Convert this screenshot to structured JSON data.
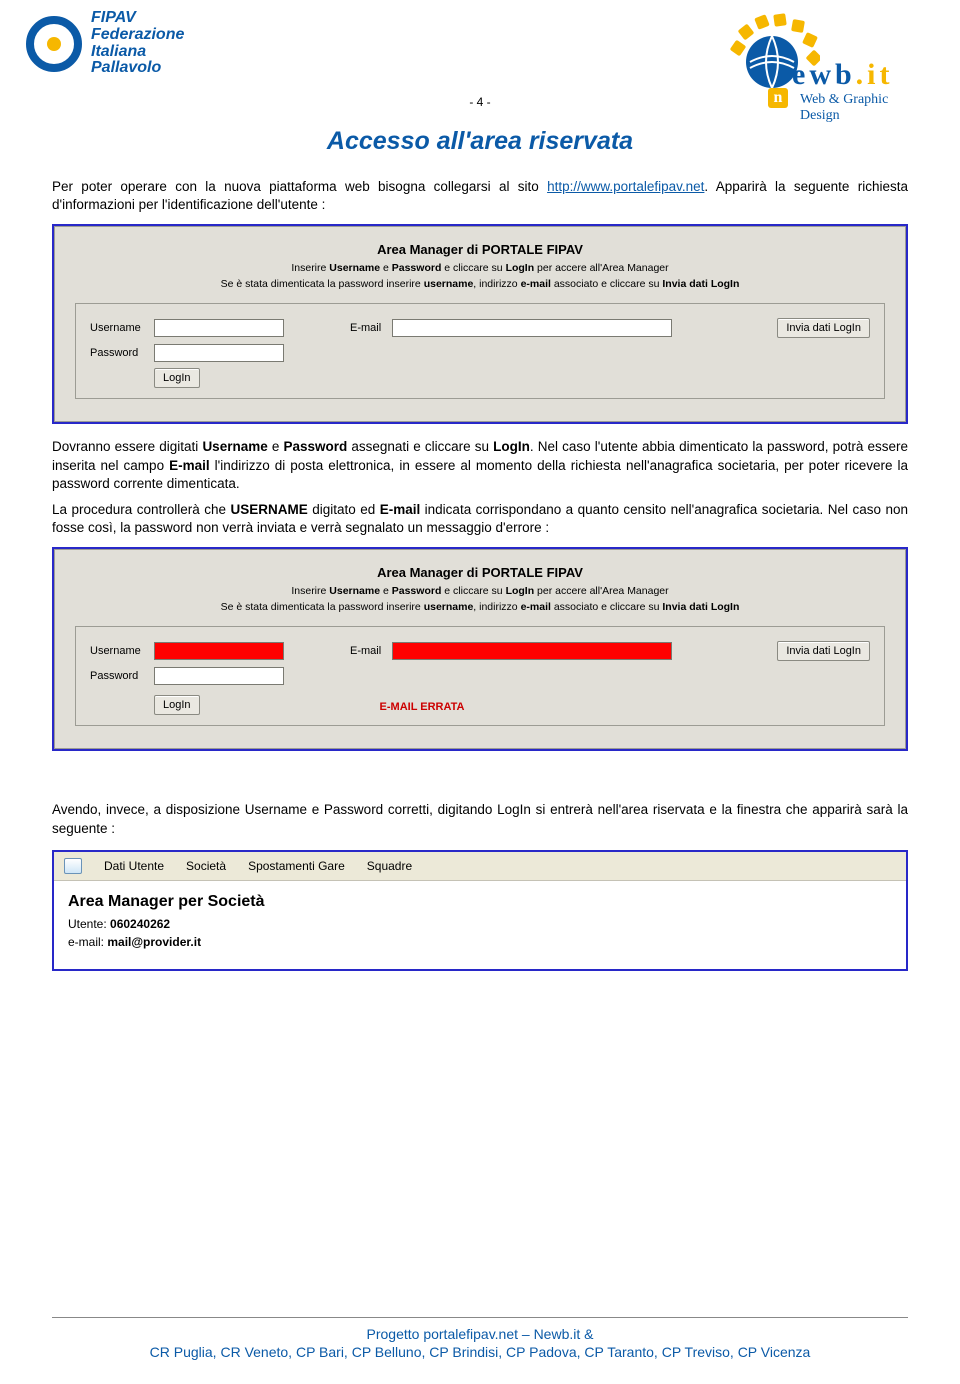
{
  "header": {
    "page_number": "- 4 -",
    "fipav": {
      "line1": "FIPAV",
      "line2": "Federazione",
      "line3": "Italiana",
      "line4": "Pallavolo"
    },
    "newb": {
      "brand_part1": "ewb",
      "brand_part2": ".it",
      "tag": "Web & Graphic Design",
      "n": "n"
    }
  },
  "title": "Accesso all'area riservata",
  "intro_pre": "Per poter operare con la nuova piattaforma web bisogna collegarsi al sito ",
  "intro_link": "http://www.portalefipav.net",
  "intro_post": ". Apparirà la seguente richiesta d'informazioni per l'identificazione dell'utente :",
  "panel1": {
    "title": "Area Manager di PORTALE FIPAV",
    "sub1_a": "Inserire ",
    "sub1_b": "Username",
    "sub1_c": " e ",
    "sub1_d": "Password",
    "sub1_e": " e cliccare su ",
    "sub1_f": "LogIn",
    "sub1_g": " per accere all'Area Manager",
    "sub2_a": "Se è stata dimenticata la password inserire ",
    "sub2_b": "username",
    "sub2_c": ", indirizzo ",
    "sub2_d": "e-mail",
    "sub2_e": " associato e cliccare su ",
    "sub2_f": "Invia dati LogIn",
    "username_label": "Username",
    "password_label": "Password",
    "email_label": "E-mail",
    "invia_btn": "Invia dati LogIn",
    "login_btn": "LogIn"
  },
  "para2_a": "Dovranno essere digitati ",
  "para2_b": "Username",
  "para2_c": " e ",
  "para2_d": "Password",
  "para2_e": " assegnati e cliccare su ",
  "para2_f": "LogIn",
  "para2_g": ". Nel caso l'utente abbia dimenticato la password, potrà essere inserita nel campo ",
  "para2_h": "E-mail",
  "para2_i": " l'indirizzo di posta elettronica, in essere al momento della richiesta nell'anagrafica societaria, per poter ricevere la password corrente dimenticata.",
  "para3_a": "La procedura controllerà che ",
  "para3_b": "USERNAME",
  "para3_c": " digitato ed ",
  "para3_d": "E-mail",
  "para3_e": " indicata corrispondano a quanto censito nell'anagrafica societaria. Nel caso non fosse così, la password non verrà inviata e verrà segnalato un messaggio d'errore :",
  "panel2": {
    "error": "E-MAIL ERRATA"
  },
  "para4": "Avendo, invece, a disposizione Username e Password corretti, digitando LogIn si entrerà nell'area riservata e la finestra che apparirà sarà la seguente :",
  "panel3": {
    "menu": [
      "Dati Utente",
      "Società",
      "Spostamenti Gare",
      "Squadre"
    ],
    "heading": "Area Manager per Società",
    "utente_label": "Utente: ",
    "utente_val": "060240262",
    "email_label": "e-mail: ",
    "email_val": "mail@provider.it"
  },
  "footer": {
    "l1_a": "Progetto portalefipav.net – Newb.it &",
    "l2": "CR Puglia, CR Veneto, CP Bari, CP Belluno, CP Brindisi, CP Padova, CP Taranto, CP Treviso, CP Vicenza"
  }
}
